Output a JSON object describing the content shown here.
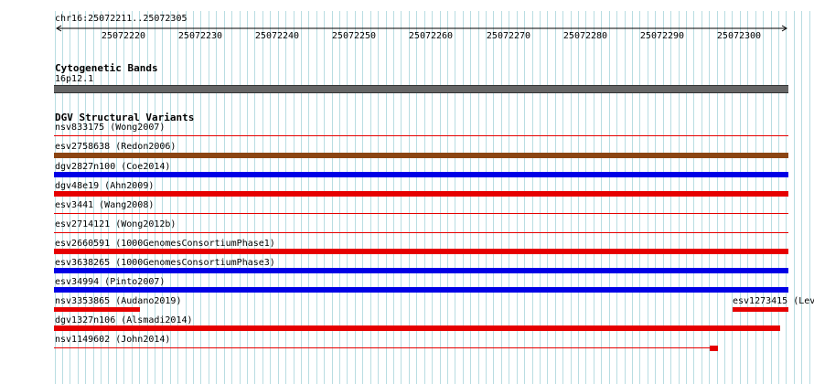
{
  "ruler": {
    "location": "chr16:25072211..25072305",
    "ticks": [
      "25072220",
      "25072230",
      "25072240",
      "25072250",
      "25072260",
      "25072270",
      "25072280",
      "25072290",
      "25072300"
    ]
  },
  "cytoband": {
    "title": "Cytogenetic Bands",
    "band_label": "16p12.1",
    "color": "#666666"
  },
  "dgv": {
    "title": "DGV Structural Variants",
    "variants": [
      {
        "label": "nsv833175 (Wong2007)",
        "color": "#e60000"
      },
      {
        "label": "esv2758638 (Redon2006)",
        "color": "#8b4513"
      },
      {
        "label": "dgv2827n100 (Coe2014)",
        "color": "#0000e6"
      },
      {
        "label": "dgv48e19 (Ahn2009)",
        "color": "#e60000"
      },
      {
        "label": "esv3441 (Wang2008)",
        "color": "#e60000"
      },
      {
        "label": "esv2714121 (Wong2012b)",
        "color": "#e60000"
      },
      {
        "label": "esv2660591 (1000GenomesConsortiumPhase1)",
        "color": "#e60000"
      },
      {
        "label": "esv3638265 (1000GenomesConsortiumPhase3)",
        "color": "#0000e6"
      },
      {
        "label": "esv34994 (Pinto2007)",
        "color": "#0000e6"
      },
      {
        "label": "nsv3353865 (Audano2019)",
        "label2": "esv1273415 (Lev",
        "color": "#e60000"
      },
      {
        "label": "dgv1327n106 (Alsmadi2014)",
        "color": "#e60000"
      },
      {
        "label": "nsv1149602 (John2014)",
        "color": "#e60000"
      }
    ]
  }
}
